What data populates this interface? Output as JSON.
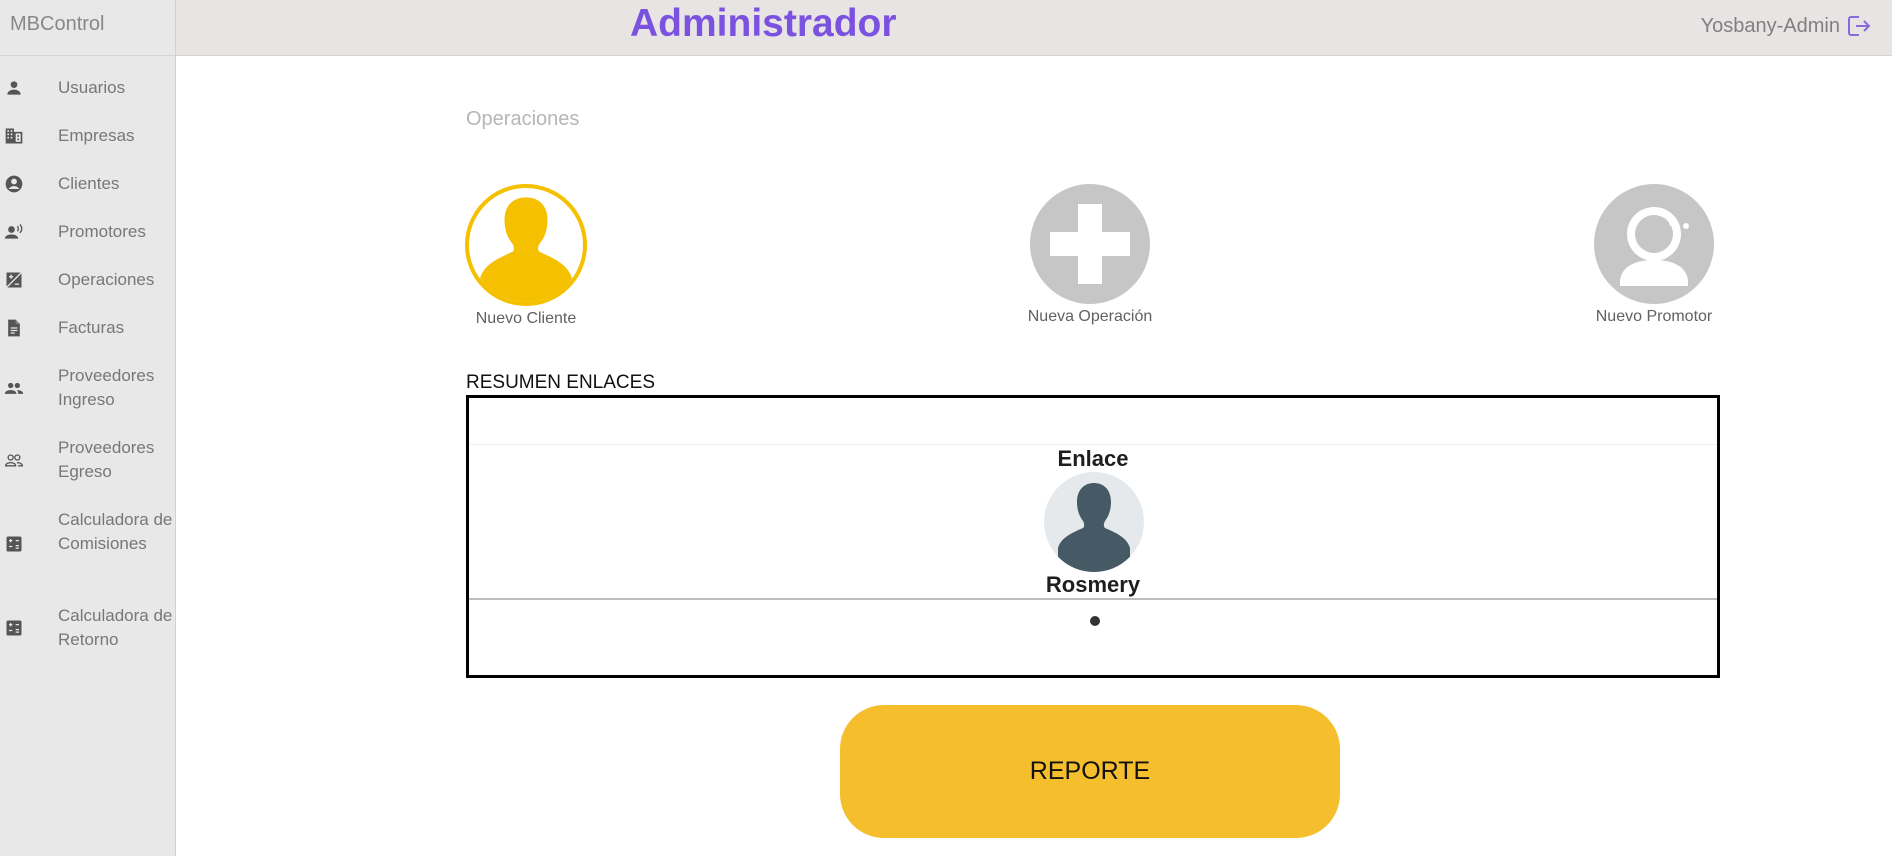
{
  "sidebar": {
    "brand": "MBControl",
    "items": [
      {
        "label": "Usuarios",
        "icon": "person-icon"
      },
      {
        "label": "Empresas",
        "icon": "building-icon"
      },
      {
        "label": "Clientes",
        "icon": "account-circle-icon"
      },
      {
        "label": "Promotores",
        "icon": "record-voice-icon"
      },
      {
        "label": "Operaciones",
        "icon": "exposure-icon"
      },
      {
        "label": "Facturas",
        "icon": "document-icon"
      },
      {
        "label": "Proveedores Ingreso",
        "icon": "group-icon"
      },
      {
        "label": "Proveedores Egreso",
        "icon": "group-outline-icon"
      },
      {
        "label": "Calculadora de Comisiones",
        "icon": "calculator-icon"
      },
      {
        "label": "Calculadora de Retorno",
        "icon": "calculator-icon"
      }
    ]
  },
  "header": {
    "title": "Administrador",
    "user_name": "Yosbany-Admin",
    "logout_icon": "logout-icon"
  },
  "main": {
    "section_title": "Operaciones",
    "shortcuts": [
      {
        "label": "Nuevo Cliente",
        "icon": "person-silhouette-icon",
        "color": "#f5c000",
        "selected": true
      },
      {
        "label": "Nueva Operación",
        "icon": "plus-icon",
        "color": "#c6c6c6",
        "selected": false
      },
      {
        "label": "Nuevo Promotor",
        "icon": "astronaut-icon",
        "color": "#c6c6c6",
        "selected": false
      }
    ],
    "summary": {
      "title": "RESUMEN ENLACES",
      "enlace_label": "Enlace",
      "enlace_name": "Rosmery",
      "avatar_icon": "person-silhouette-icon"
    },
    "report_button": "REPORTE"
  },
  "colors": {
    "accent": "#7b52e0",
    "report": "#f5be2c",
    "selected": "#f5c000",
    "inactive": "#c6c6c6",
    "avatar": "#455a64"
  }
}
